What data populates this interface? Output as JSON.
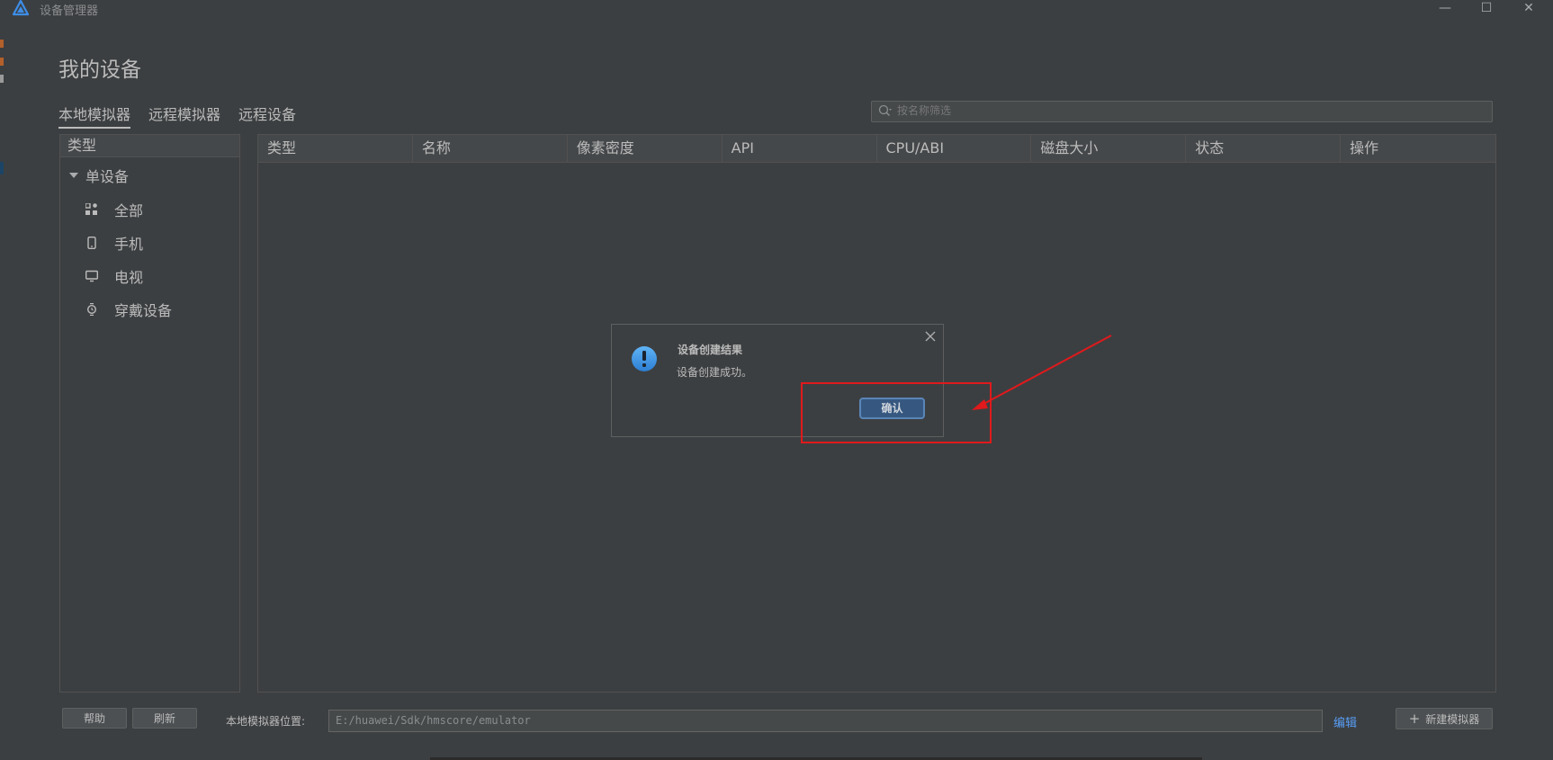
{
  "window": {
    "title": "设备管理器",
    "minimize": "—",
    "maximize": "☐",
    "close": "✕"
  },
  "page": {
    "title": "我的设备"
  },
  "tabs": [
    {
      "label": "本地模拟器",
      "active": true
    },
    {
      "label": "远程模拟器",
      "active": false
    },
    {
      "label": "远程设备",
      "active": false
    }
  ],
  "search": {
    "placeholder": "按名称筛选",
    "value": ""
  },
  "category_panel": {
    "header": "类型",
    "group": "单设备",
    "items": [
      {
        "label": "全部",
        "icon": "all-devices-icon"
      },
      {
        "label": "手机",
        "icon": "phone-icon"
      },
      {
        "label": "电视",
        "icon": "tv-icon"
      },
      {
        "label": "穿戴设备",
        "icon": "watch-icon"
      }
    ]
  },
  "table": {
    "columns": [
      "类型",
      "名称",
      "像素密度",
      "API",
      "CPU/ABI",
      "磁盘大小",
      "状态",
      "操作"
    ],
    "rows": []
  },
  "dialog": {
    "title": "设备创建结果",
    "message": "设备创建成功。",
    "confirm_label": "确认",
    "icon": "info-icon"
  },
  "annotation": {
    "color": "#e0191c"
  },
  "bottom": {
    "help_label": "帮助",
    "refresh_label": "刷新",
    "location_label": "本地模拟器位置:",
    "location_value": "E:/huawei/Sdk/hmscore/emulator",
    "edit_label": "编辑",
    "new_emulator_label": "新建模拟器"
  },
  "colors": {
    "background": "#3c3f41",
    "accent": "#365880",
    "link": "#589df6"
  }
}
